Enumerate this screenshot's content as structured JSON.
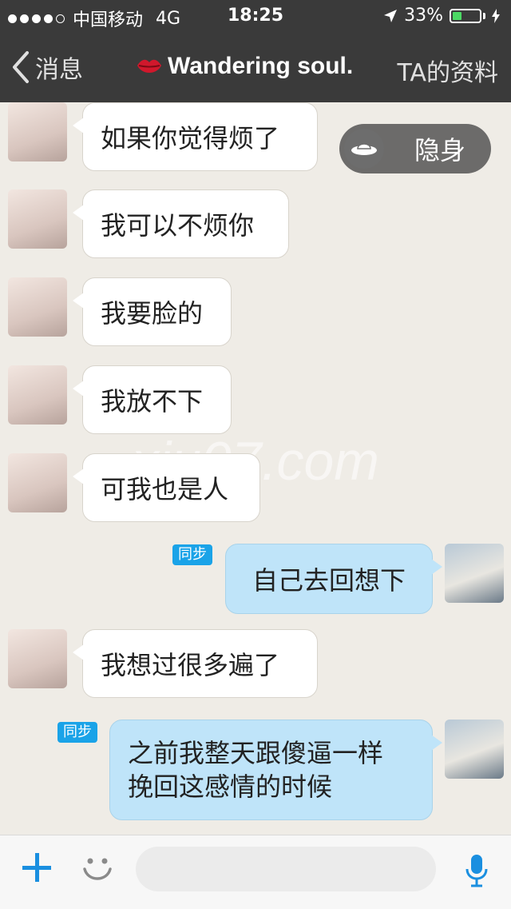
{
  "status_bar": {
    "carrier": "中国移动",
    "network": "4G",
    "time": "18:25",
    "battery": "33%",
    "battery_level": 0.33
  },
  "nav": {
    "back_label": "消息",
    "title": "Wandering soul.",
    "right_label": "TA的资料"
  },
  "hide_toggle_label": "隐身",
  "watermark": "xiu07.com",
  "messages": [
    {
      "from": "her",
      "text": "如果你觉得烦了"
    },
    {
      "from": "her",
      "text": "我可以不烦你"
    },
    {
      "from": "her",
      "text": "我要脸的"
    },
    {
      "from": "her",
      "text": "我放不下"
    },
    {
      "from": "her",
      "text": "可我也是人"
    },
    {
      "from": "me",
      "badge": "同步",
      "text": "自己去回想下"
    },
    {
      "from": "her",
      "text": "我想过很多遍了"
    },
    {
      "from": "me",
      "badge": "同步",
      "lines": [
        "之前我整天跟傻逼一样",
        "挽回这感情的时候"
      ]
    }
  ],
  "input": {
    "placeholder": ""
  },
  "colors": {
    "bar_bg": "#3a3a3a",
    "chat_bg": "#efece6",
    "bubble_out": "#bfe4f9",
    "sync_badge": "#1aa3e8",
    "accent": "#1a8fe0",
    "battery_green": "#4cd964"
  },
  "icons": [
    "signal-dots-icon",
    "location-arrow-icon",
    "battery-icon",
    "charging-icon",
    "back-chevron-icon",
    "lips-icon",
    "ufo-icon",
    "plus-icon",
    "emoji-icon",
    "microphone-icon"
  ]
}
